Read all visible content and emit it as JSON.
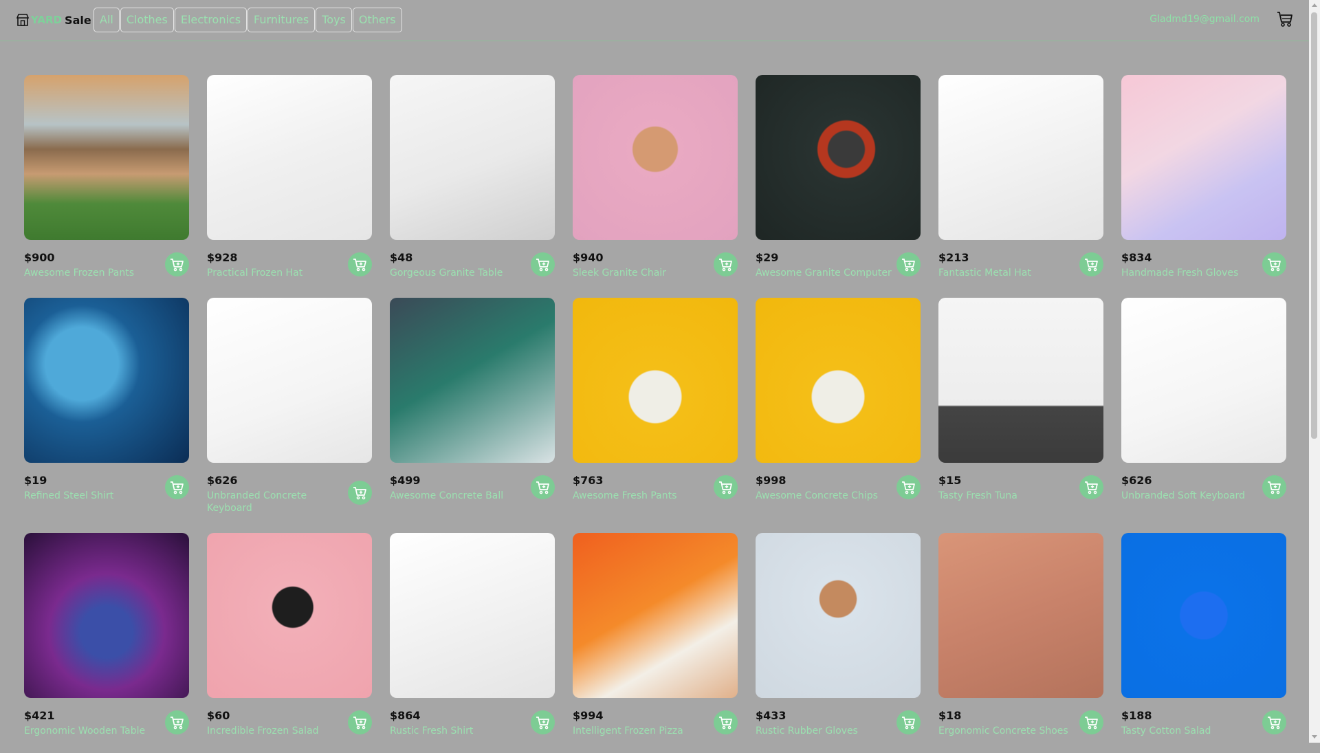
{
  "brand": {
    "yard": "YARD",
    "sale": "Sale"
  },
  "categories": [
    "All",
    "Clothes",
    "Electronics",
    "Furnitures",
    "Toys",
    "Others"
  ],
  "user": {
    "email": "Gladmd19@gmail.com"
  },
  "colors": {
    "background": "#a6a6a6",
    "accent": "#7dcc94",
    "accent_text": "#9be0b0"
  },
  "products": [
    {
      "price": "$900",
      "name": "Awesome Frozen Pants",
      "image": "house"
    },
    {
      "price": "$928",
      "name": "Practical Frozen Hat",
      "image": "white-stool"
    },
    {
      "price": "$48",
      "name": "Gorgeous Granite Table",
      "image": "black-chair"
    },
    {
      "price": "$940",
      "name": "Sleek Granite Chair",
      "image": "woman-pink"
    },
    {
      "price": "$29",
      "name": "Awesome Granite Computer",
      "image": "watch-dark"
    },
    {
      "price": "$213",
      "name": "Fantastic Metal Hat",
      "image": "sneakers-colorful"
    },
    {
      "price": "$834",
      "name": "Handmade Fresh Gloves",
      "image": "sneaker-pastel"
    },
    {
      "price": "$19",
      "name": "Refined Steel Shirt",
      "image": "book-cover"
    },
    {
      "price": "$626",
      "name": "Unbranded Concrete Keyboard",
      "image": "watch-airpods"
    },
    {
      "price": "$499",
      "name": "Awesome Concrete Ball",
      "image": "watch-green"
    },
    {
      "price": "$763",
      "name": "Awesome Fresh Pants",
      "image": "woman-yellow"
    },
    {
      "price": "$998",
      "name": "Awesome Concrete Chips",
      "image": "woman-yellow"
    },
    {
      "price": "$15",
      "name": "Tasty Fresh Tuna",
      "image": "chair-black-shell"
    },
    {
      "price": "$626",
      "name": "Unbranded Soft Keyboard",
      "image": "sneaker-black"
    },
    {
      "price": "$421",
      "name": "Ergonomic Wooden Table",
      "image": "movie-poster"
    },
    {
      "price": "$60",
      "name": "Incredible Frozen Salad",
      "image": "woman-pink-wall"
    },
    {
      "price": "$864",
      "name": "Rustic Fresh Shirt",
      "image": "sneakers-colorful"
    },
    {
      "price": "$994",
      "name": "Intelligent Frozen Pizza",
      "image": "sneaker-orange"
    },
    {
      "price": "$433",
      "name": "Rustic Rubber Gloves",
      "image": "woman-curly"
    },
    {
      "price": "$18",
      "name": "Ergonomic Concrete Shoes",
      "image": "watch-wood"
    },
    {
      "price": "$188",
      "name": "Tasty Cotton Salad",
      "image": "sneaker-blue"
    }
  ]
}
